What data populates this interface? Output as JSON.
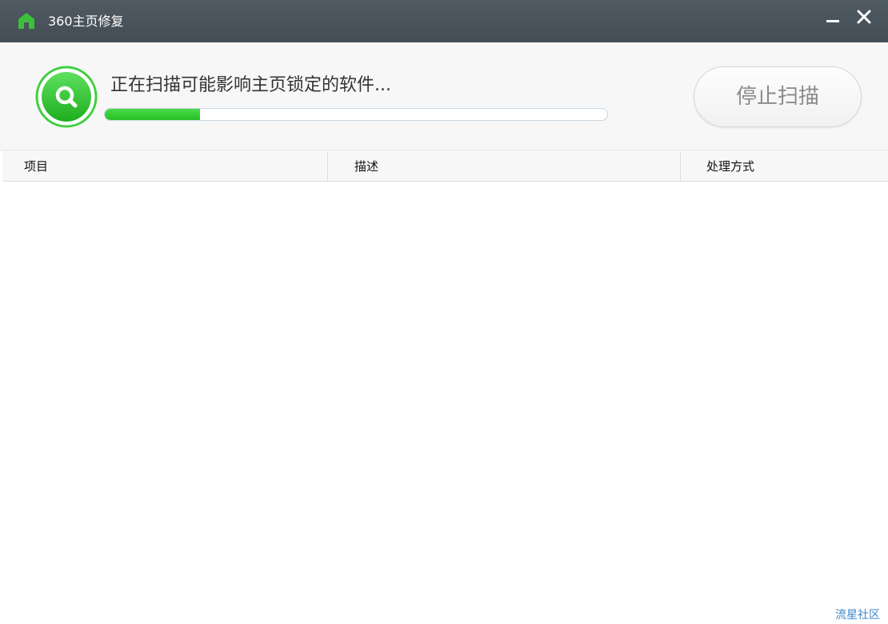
{
  "window": {
    "title": "360主页修复",
    "app_icon": "house-icon",
    "minimize_icon": "minimize-icon",
    "close_icon": "close-icon",
    "titlebar_color": "#4a555d"
  },
  "scan": {
    "icon": "search-icon",
    "status_text": "正在扫描可能影响主页锁定的软件...",
    "progress": 0.19,
    "accent_color": "#2ec12e",
    "stop_button_label": "停止扫描"
  },
  "table": {
    "columns": [
      "项目",
      "描述",
      "处理方式"
    ],
    "rows": []
  },
  "footer": {
    "watermark": "流星社区"
  }
}
